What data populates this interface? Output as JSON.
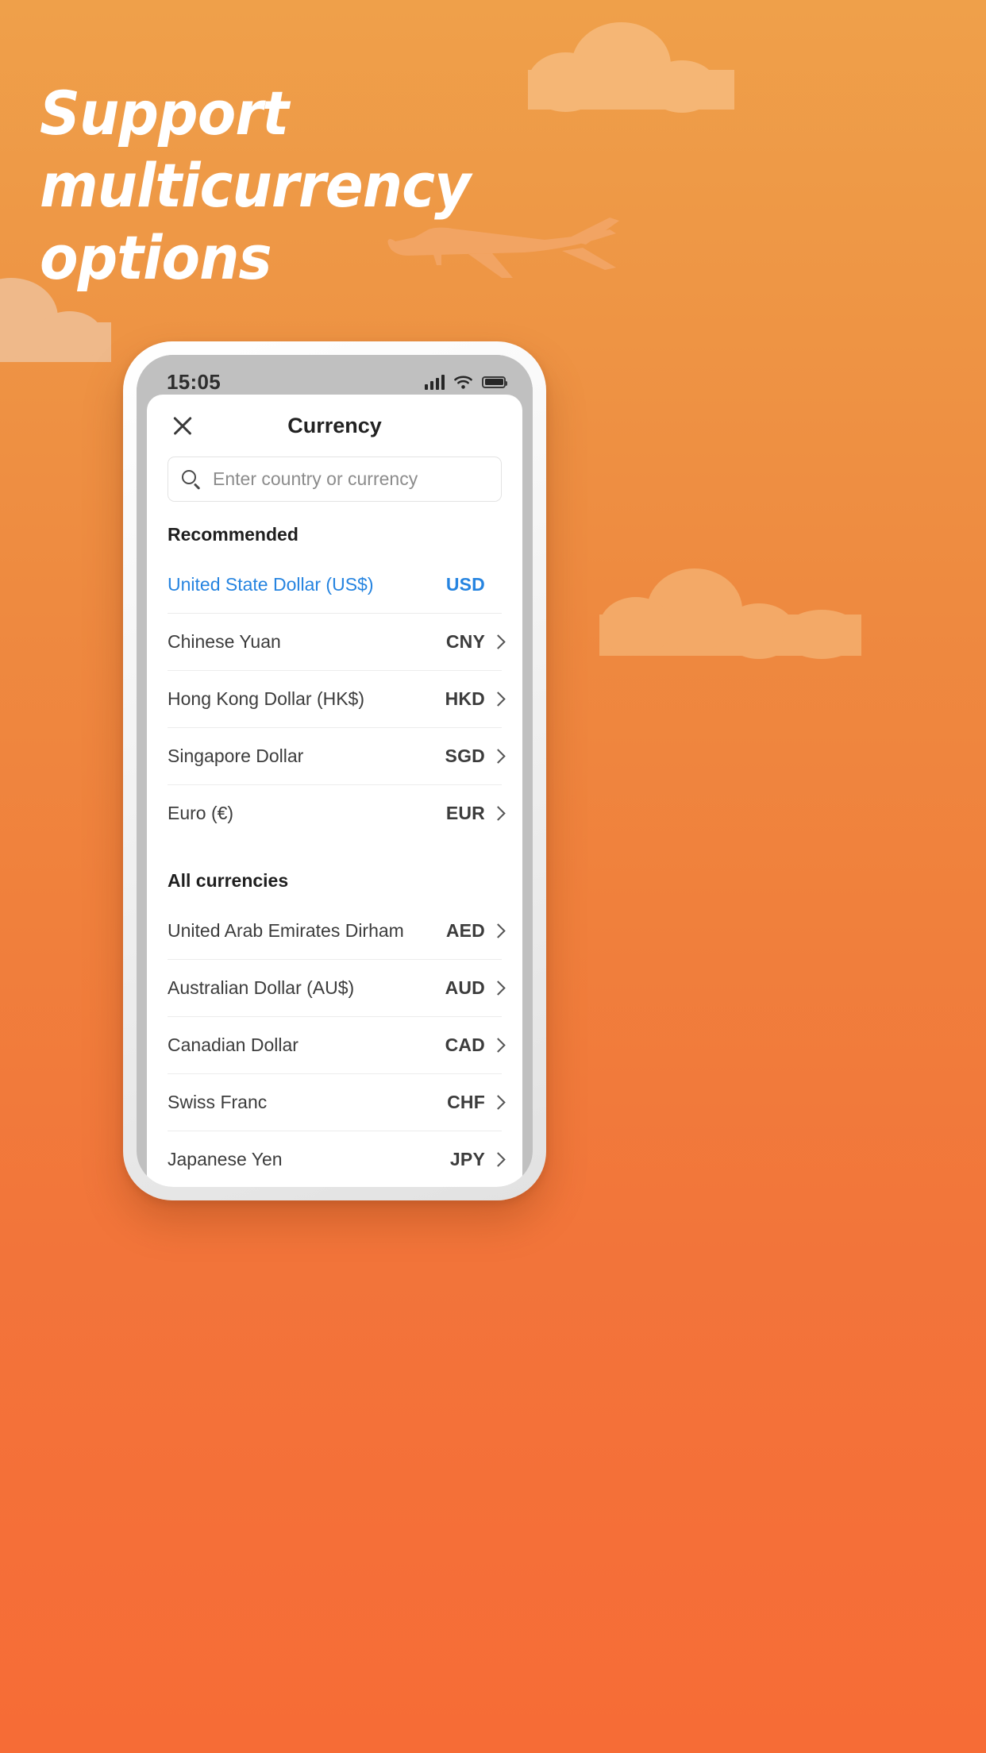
{
  "marketing": {
    "headline": "Support multicurrency\noptions",
    "background": {
      "top_color": "#EFA04A",
      "bottom_color": "#F66C36",
      "cloud_color": "#F5B675",
      "plane_color": "#F2A463"
    }
  },
  "phone": {
    "status_bar": {
      "time": "15:05",
      "icons": [
        "signal-icon",
        "wifi-icon",
        "battery-icon"
      ]
    }
  },
  "sheet": {
    "close_icon": "close-icon",
    "title": "Currency",
    "search": {
      "icon": "search-icon",
      "placeholder": "Enter country or currency",
      "value": ""
    },
    "sections": [
      {
        "title": "Recommended",
        "items": [
          {
            "name": "United State Dollar (US$)",
            "code": "USD",
            "selected": true,
            "chevron": false
          },
          {
            "name": "Chinese Yuan",
            "code": "CNY",
            "selected": false,
            "chevron": true
          },
          {
            "name": "Hong Kong Dollar (HK$)",
            "code": "HKD",
            "selected": false,
            "chevron": true
          },
          {
            "name": "Singapore Dollar",
            "code": "SGD",
            "selected": false,
            "chevron": true
          },
          {
            "name": "Euro (€)",
            "code": "EUR",
            "selected": false,
            "chevron": true
          }
        ]
      },
      {
        "title": "All currencies",
        "items": [
          {
            "name": "United Arab Emirates Dirham",
            "code": "AED",
            "selected": false,
            "chevron": true
          },
          {
            "name": "Australian Dollar (AU$)",
            "code": "AUD",
            "selected": false,
            "chevron": true
          },
          {
            "name": "Canadian Dollar",
            "code": "CAD",
            "selected": false,
            "chevron": true
          },
          {
            "name": "Swiss Franc",
            "code": "CHF",
            "selected": false,
            "chevron": true
          },
          {
            "name": "Japanese Yen",
            "code": "JPY",
            "selected": false,
            "chevron": true
          }
        ]
      }
    ],
    "accent_color": "#2684E0"
  }
}
